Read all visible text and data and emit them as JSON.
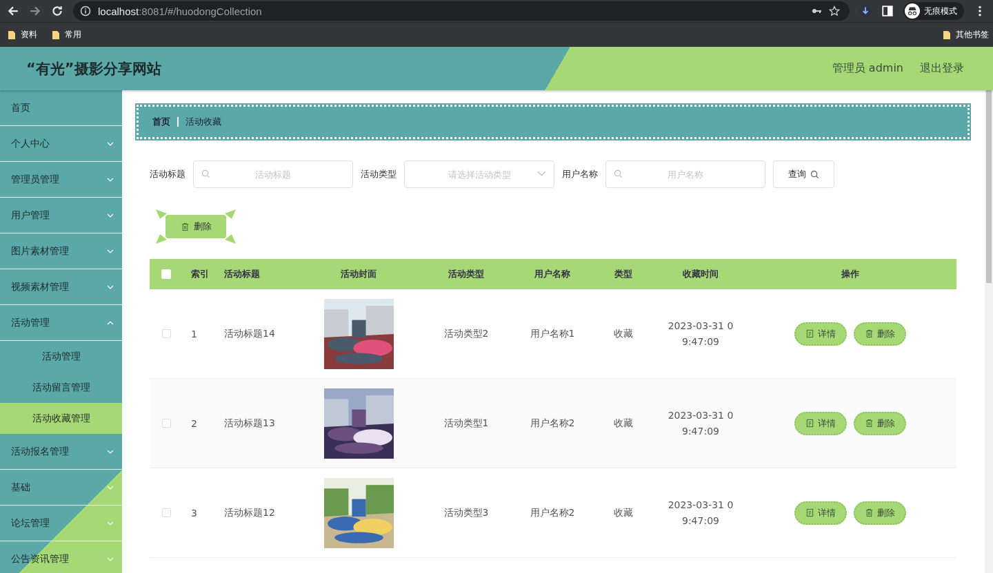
{
  "browser": {
    "url_host": "localhost",
    "url_rest": ":8081/#/huodongCollection",
    "incognito_label": "无痕模式",
    "bookmarks": [
      "资料",
      "常用"
    ],
    "other_bookmarks": "其他书签"
  },
  "header": {
    "title": "“有光”摄影分享网站",
    "user": "管理员 admin",
    "logout": "退出登录"
  },
  "sidebar": {
    "items": [
      {
        "label": "首页",
        "selected": false
      },
      {
        "label": "个人中心",
        "selected": false,
        "expanded": false
      },
      {
        "label": "管理员管理",
        "selected": false,
        "expanded": false
      },
      {
        "label": "用户管理",
        "selected": false,
        "expanded": false
      },
      {
        "label": "图片素材管理",
        "selected": false,
        "expanded": false
      },
      {
        "label": "视频素材管理",
        "selected": false,
        "expanded": false
      },
      {
        "label": "活动管理",
        "selected": false,
        "expanded": true,
        "children": [
          {
            "label": "活动管理",
            "selected": false
          },
          {
            "label": "活动留言管理",
            "selected": false
          },
          {
            "label": "活动收藏管理",
            "selected": true
          }
        ]
      },
      {
        "label": "活动报名管理",
        "selected": false,
        "expanded": false
      },
      {
        "label": "基础",
        "selected": false,
        "expanded": false
      },
      {
        "label": "论坛管理",
        "selected": false,
        "expanded": false
      },
      {
        "label": "公告资讯管理",
        "selected": false,
        "expanded": false
      }
    ]
  },
  "breadcrumb": [
    "首页",
    "活动收藏"
  ],
  "filters": [
    {
      "kind": "search",
      "label": "活动标题",
      "placeholder": "活动标题"
    },
    {
      "kind": "select",
      "label": "活动类型",
      "placeholder": "请选择活动类型"
    },
    {
      "kind": "search",
      "label": "用户名称",
      "placeholder": "用户名称"
    }
  ],
  "query_button": "查询",
  "delete_button": "删除",
  "table": {
    "all_checked": false,
    "columns": [
      "索引",
      "活动标题",
      "活动封面",
      "活动类型",
      "用户名称",
      "类型",
      "收藏时间",
      "操作"
    ],
    "rows": [
      {
        "checked": false,
        "index": "1",
        "title": "活动标题14",
        "cover": {
          "kind": "picture"
        },
        "type": "活动类型2",
        "user": "用户名称1",
        "kind": "收藏",
        "time": "2023-03-31 0\n9:47:09",
        "actions": [
          "详情",
          "删除"
        ]
      },
      {
        "checked": false,
        "index": "2",
        "title": "活动标题13",
        "cover": {
          "kind": "picture"
        },
        "type": "活动类型1",
        "user": "用户名称2",
        "kind": "收藏",
        "time": "2023-03-31 0\n9:47:09",
        "actions": [
          "详情",
          "删除"
        ]
      },
      {
        "checked": false,
        "index": "3",
        "title": "活动标题12",
        "cover": {
          "kind": "picture"
        },
        "type": "活动类型3",
        "user": "用户名称2",
        "kind": "收藏",
        "time": "2023-03-31 0\n9:47:09",
        "actions": [
          "详情",
          "删除"
        ]
      }
    ]
  }
}
